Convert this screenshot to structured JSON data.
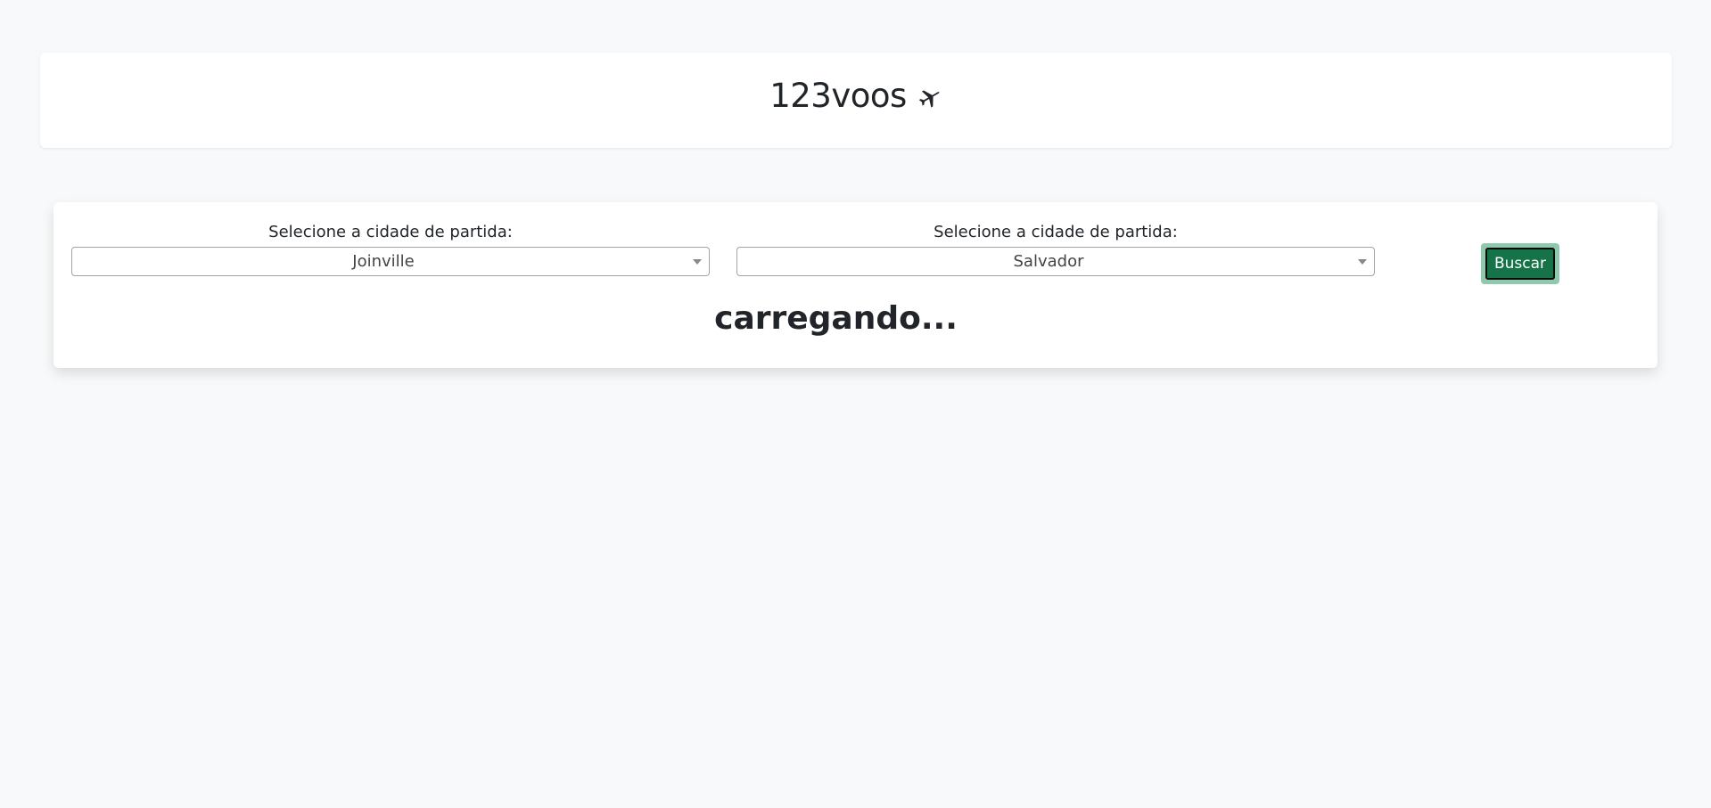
{
  "header": {
    "title": "123voos",
    "icon": "airplane-icon"
  },
  "search": {
    "origin": {
      "label": "Selecione a cidade de partida:",
      "value": "Joinville"
    },
    "destination": {
      "label": "Selecione a cidade de partida:",
      "value": "Salvador"
    },
    "button_label": "Buscar",
    "button_color": "#157347",
    "status_text": "carregando..."
  },
  "colors": {
    "background": "#f8f9fa",
    "card": "#ffffff",
    "text": "#212529"
  }
}
